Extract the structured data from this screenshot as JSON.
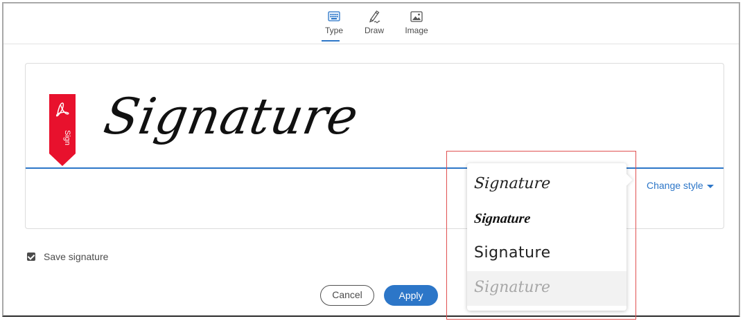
{
  "tabs": [
    {
      "label": "Type",
      "icon": "keyboard-icon",
      "selected": true
    },
    {
      "label": "Draw",
      "icon": "pen-draw-icon",
      "selected": false
    },
    {
      "label": "Image",
      "icon": "image-icon",
      "selected": false
    }
  ],
  "signature": {
    "text": "Signature",
    "flag_label": "Sign",
    "flag_icon": "acrobat-icon"
  },
  "change_style": {
    "label": "Change style"
  },
  "style_options": [
    {
      "text": "Signature"
    },
    {
      "text": "Signature"
    },
    {
      "text": "Signature"
    },
    {
      "text": "Signature",
      "hovered": true
    }
  ],
  "save_signature": {
    "label": "Save signature",
    "checked": true
  },
  "buttons": {
    "cancel": "Cancel",
    "apply": "Apply"
  },
  "colors": {
    "accent": "#2c76c8",
    "flag_red": "#e8112d",
    "highlight_box": "#e05050"
  }
}
